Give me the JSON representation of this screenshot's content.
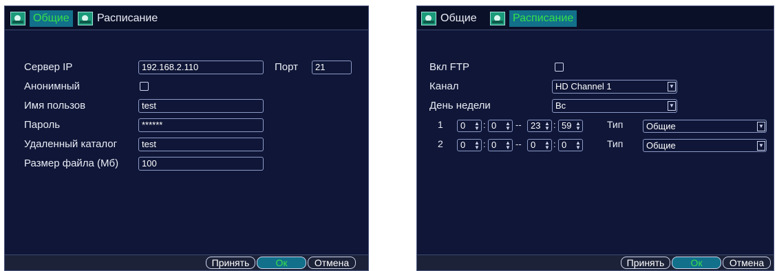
{
  "left": {
    "tabs": [
      "Общие",
      "Расписание"
    ],
    "labels": {
      "server_ip": "Сервер IP",
      "port": "Порт",
      "anonymous": "Анонимный",
      "username": "Имя пользов",
      "password": "Пароль",
      "remote_dir": "Удаленный каталог",
      "file_size": "Размер файла (Мб)"
    },
    "values": {
      "server_ip": "192.168.2.110",
      "port": "21",
      "username": "test",
      "password": "******",
      "remote_dir": "test",
      "file_size": "100"
    },
    "buttons": {
      "apply": "Принять",
      "ok": "Ок",
      "cancel": "Отмена"
    }
  },
  "right": {
    "tabs": [
      "Общие",
      "Расписание"
    ],
    "labels": {
      "enable_ftp": "Вкл FTP",
      "channel": "Канал",
      "weekday": "День недели",
      "type": "Тип"
    },
    "values": {
      "channel": "HD Channel 1",
      "weekday": "Вс"
    },
    "schedule": [
      {
        "index": "1",
        "start_h": "0",
        "start_m": "0",
        "end_h": "23",
        "end_m": "59",
        "type": "Общие"
      },
      {
        "index": "2",
        "start_h": "0",
        "start_m": "0",
        "end_h": "0",
        "end_m": "0",
        "type": "Общие"
      }
    ],
    "separators": {
      "colon": ":",
      "range": "--"
    },
    "buttons": {
      "apply": "Принять",
      "ok": "Ок",
      "cancel": "Отмена"
    }
  },
  "icons": {
    "tab": "camera-tab-icon",
    "spinner": "spinner-arrows-icon",
    "dropdown": "dropdown-arrow-icon"
  },
  "colors": {
    "background": "#0f1637",
    "active_tab_text": "#36e04a",
    "active_tab_bg": "#12708b"
  }
}
